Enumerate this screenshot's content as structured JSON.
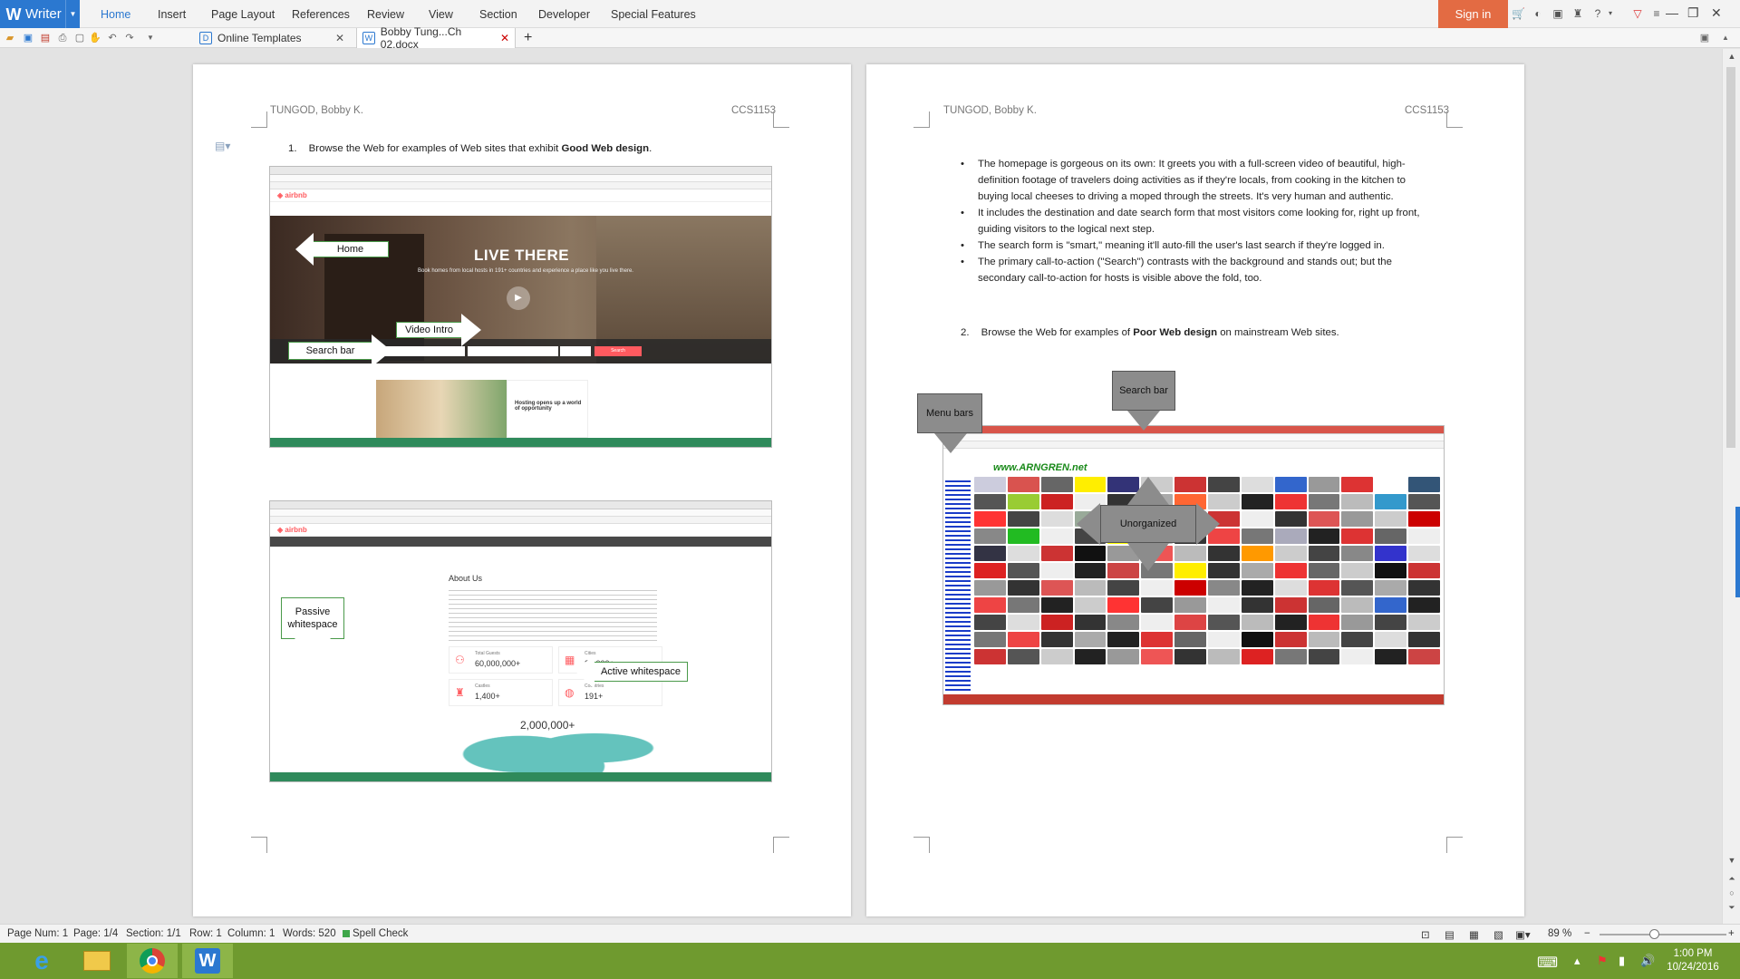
{
  "app": {
    "name": "Writer",
    "logo": "W"
  },
  "menu": {
    "tabs": [
      "Home",
      "Insert",
      "Page Layout",
      "References",
      "Review",
      "View",
      "Section",
      "Developer",
      "Special Features"
    ],
    "active": "Home",
    "signin": "Sign in"
  },
  "tabs": {
    "templates": "Online Templates",
    "document": "Bobby Tung...Ch 02.docx",
    "add": "+"
  },
  "page1": {
    "header_left": "TUNGOD, Bobby K.",
    "header_right": "CCS1153",
    "item_num": "1.",
    "item_text_pre": "Browse the Web for examples of Web sites that exhibit ",
    "item_text_bold": "Good Web design",
    "item_text_post": ".",
    "shot1": {
      "hero_title": "LIVE THERE",
      "hero_sub": "Book homes from local hosts in 191+ countries and experience a place like you live there.",
      "search_btn": "Search",
      "promo_title": "Hosting opens up a world of opportunity",
      "callout_home": "Home",
      "callout_video": "Video Intro",
      "callout_search": "Search bar"
    },
    "shot2": {
      "about_title": "About Us",
      "stat1_label": "Total Guests",
      "stat1_value": "60,000,000+",
      "stat2_label": "Cities",
      "stat2_value": "34,000+",
      "stat3_label": "Castles",
      "stat3_value": "1,400+",
      "stat4_label": "Countries",
      "stat4_value": "191+",
      "map_value": "2,000,000+",
      "callout_passive": "Passive whitespace",
      "callout_active": "Active whitespace"
    }
  },
  "page2": {
    "header_left": "TUNGOD, Bobby K.",
    "header_right": "CCS1153",
    "bullets": [
      "The homepage is gorgeous on its own: It greets you with a full-screen video of beautiful, high-definition footage of travelers doing activities as if they're locals, from cooking in the kitchen to buying local cheeses to driving a moped through the streets. It's very human and authentic.",
      "It includes the destination and date search form that most visitors come looking for, right up front, guiding visitors to the logical next step.",
      "The search form is \"smart,\" meaning it'll auto-fill the user's last search if they're logged in.",
      "The primary call-to-action (\"Search\") contrasts with the background and stands out; but the secondary call-to-action for hosts is visible above the fold, too."
    ],
    "item2_num": "2.",
    "item2_pre": "Browse the Web for examples of ",
    "item2_bold": "Poor Web design",
    "item2_post": " on mainstream Web sites.",
    "callout_menu": "Menu bars",
    "callout_search": "Search bar",
    "callout_unorganized": "Unorganized",
    "site_logo": "www.ARNGREN.net"
  },
  "status": {
    "page_num": "Page Num: 1",
    "page": "Page: 1/4",
    "section": "Section: 1/1",
    "row": "Row: 1",
    "column": "Column: 1",
    "words": "Words: 520",
    "spell": "Spell Check",
    "zoom": "89 %"
  },
  "taskbar": {
    "time": "1:00 PM",
    "date": "10/24/2016"
  },
  "colors": {
    "accent": "#2b78d0",
    "signin": "#e36b43",
    "taskbar": "#6f9a2f",
    "airbnb": "#ff5a5f"
  }
}
